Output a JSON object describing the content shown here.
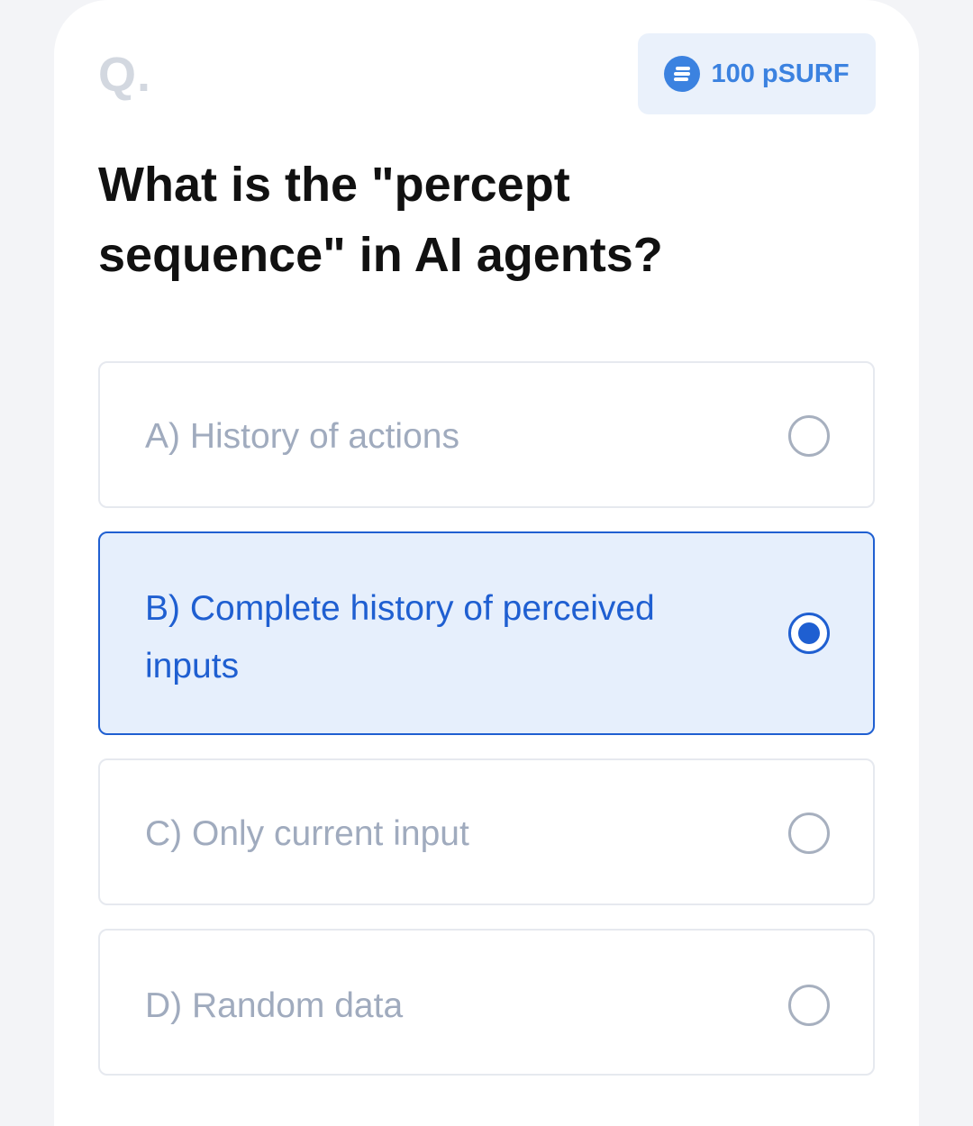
{
  "header": {
    "question_marker": "Q.",
    "reward": {
      "icon": "coin-icon",
      "label": "100 pSURF",
      "accent": "#3b82e0"
    }
  },
  "question": {
    "text": "What is the \"percept sequence\" in AI agents?"
  },
  "options": [
    {
      "label": "A) History of actions",
      "selected": false
    },
    {
      "label": "B) Complete history of perceived inputs",
      "selected": true
    },
    {
      "label": "C) Only current input",
      "selected": false
    },
    {
      "label": "D) Random data",
      "selected": false
    }
  ],
  "colors": {
    "selected_border": "#1f5fd1",
    "selected_background": "#e6effc",
    "unselected_text": "#a0abbe"
  }
}
